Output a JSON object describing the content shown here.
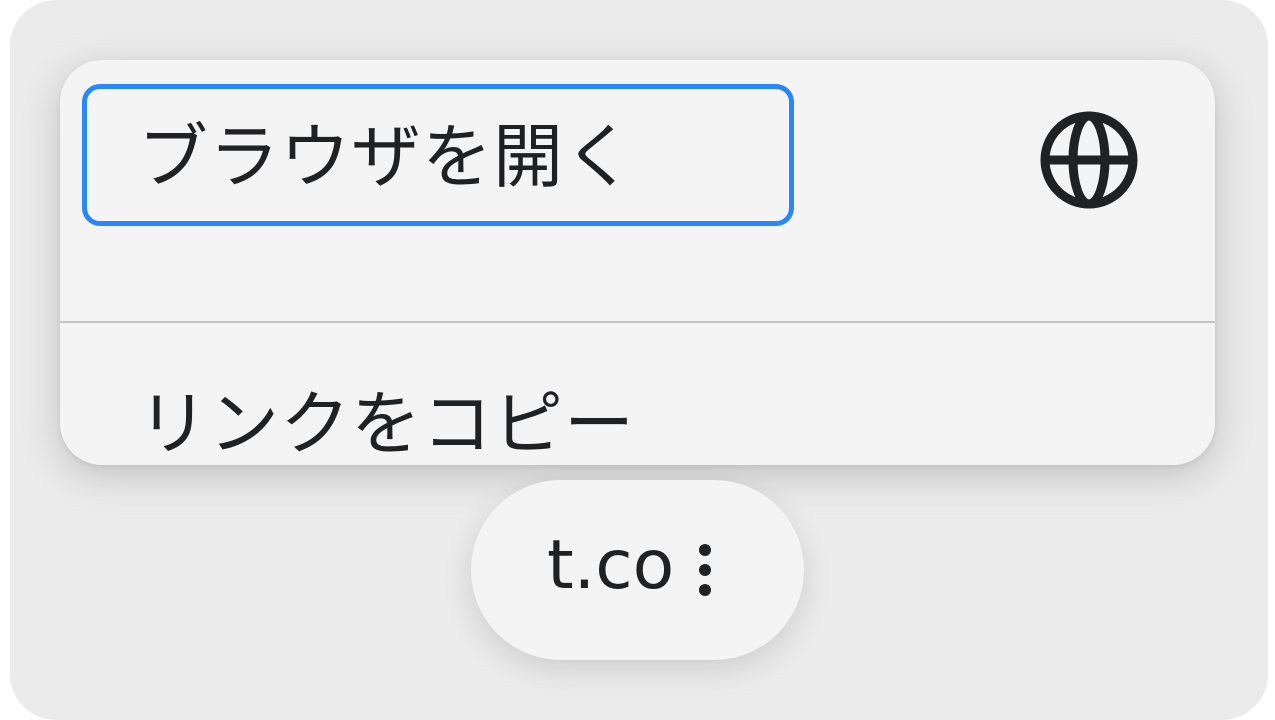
{
  "menu": {
    "items": [
      {
        "label": "ブラウザを開く",
        "icon": "globe-icon",
        "focused": true
      },
      {
        "label": "リンクをコピー",
        "icon": "copy-icon",
        "focused": false
      }
    ]
  },
  "domain_pill": {
    "text": "t.co",
    "icon": "more-vertical-icon"
  },
  "colors": {
    "focus_ring": "#2a87f9",
    "text": "#1f2123",
    "card_bg": "#f4f4f5",
    "backdrop": "#ebebeb"
  }
}
